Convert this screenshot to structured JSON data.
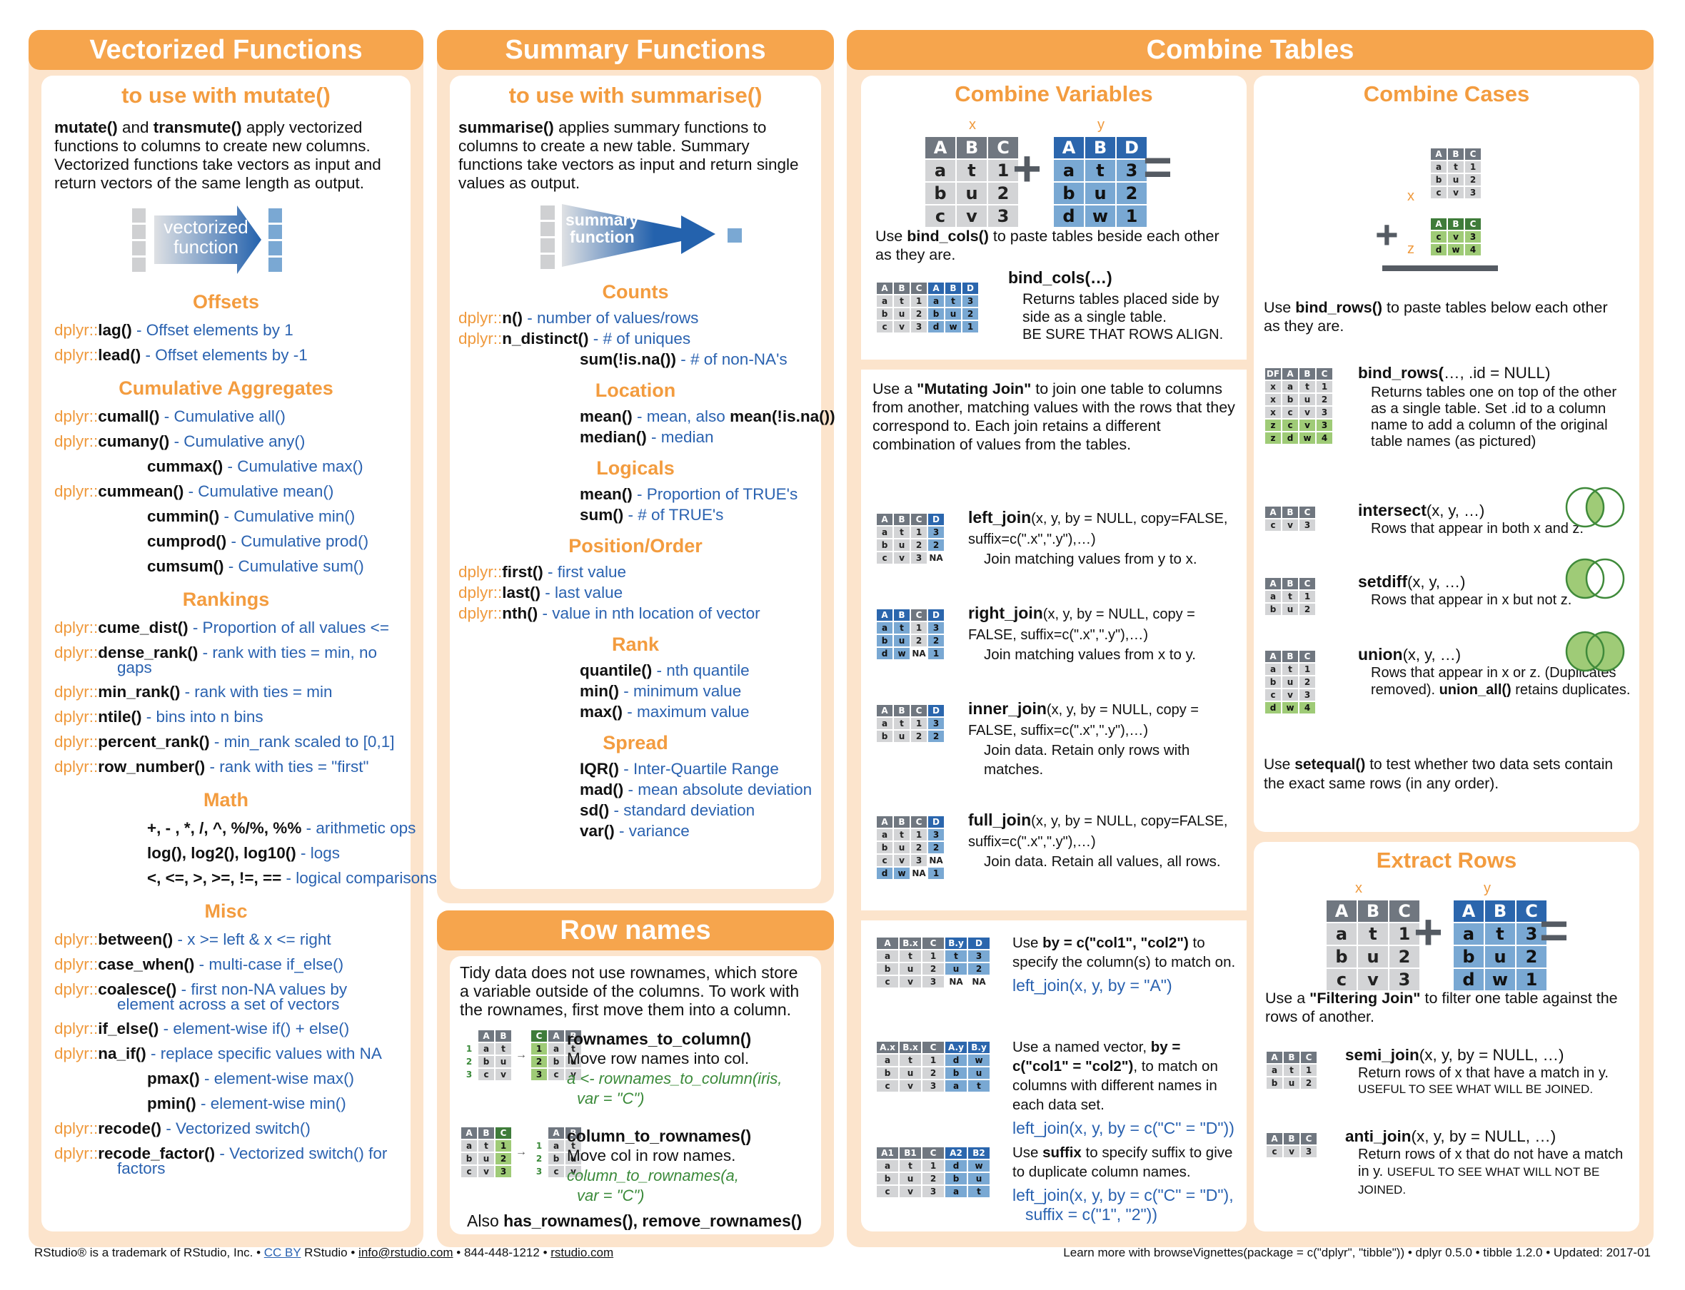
{
  "vectorized": {
    "title": "Vectorized Functions",
    "subtitle": "to use with mutate()",
    "intro_b1": "mutate()",
    "intro_t1": " and ",
    "intro_b2": "transmute()",
    "intro_t2": " apply vectorized functions to columns to create new columns. Vectorized functions take vectors as input and return vectors of the same length as output.",
    "diagram_label1": "vectorized",
    "diagram_label2": "function",
    "sections": [
      {
        "heading": "Offsets",
        "items": [
          {
            "pkg": "dplyr::",
            "name": "lag()",
            "desc": " - Offset elements by 1"
          },
          {
            "pkg": "dplyr::",
            "name": "lead()",
            "desc": " - Offset elements by -1"
          }
        ]
      },
      {
        "heading": "Cumulative Aggregates",
        "items": [
          {
            "pkg": "dplyr::",
            "name": "cumall()",
            "desc": " - Cumulative all()"
          },
          {
            "pkg": "dplyr::",
            "name": "cumany()",
            "desc": " - Cumulative any()"
          },
          {
            "pkg": "",
            "name": "cummax()",
            "desc": " - Cumulative max()"
          },
          {
            "pkg": "dplyr::",
            "name": "cummean()",
            "desc": " - Cumulative mean()"
          },
          {
            "pkg": "",
            "name": "cummin()",
            "desc": " - Cumulative min()"
          },
          {
            "pkg": "",
            "name": "cumprod()",
            "desc": " - Cumulative prod()"
          },
          {
            "pkg": "",
            "name": "cumsum()",
            "desc": " - Cumulative sum()"
          }
        ]
      },
      {
        "heading": "Rankings",
        "items": [
          {
            "pkg": "dplyr::",
            "name": "cume_dist()",
            "desc": " - Proportion of all values <="
          },
          {
            "pkg": "dplyr::",
            "name": "dense_rank()",
            "desc": " - rank with ties = min, no",
            "desc2": "gaps"
          },
          {
            "pkg": "dplyr::",
            "name": "min_rank()",
            "desc": " - rank with ties = min"
          },
          {
            "pkg": "dplyr::",
            "name": "ntile()",
            "desc": " - bins into n bins"
          },
          {
            "pkg": "dplyr::",
            "name": "percent_rank()",
            "desc": " - min_rank scaled to [0,1]"
          },
          {
            "pkg": "dplyr::",
            "name": "row_number()",
            "desc": " - rank with ties = \"first\""
          }
        ]
      },
      {
        "heading": "Math",
        "items": [
          {
            "pkg": "",
            "name": "+, - , *, /, ^, %/%, %%",
            "desc": " - arithmetic ops"
          },
          {
            "pkg": "",
            "name": "log(), log2(), log10()",
            "desc": " - logs"
          },
          {
            "pkg": "",
            "name": "<, <=, >, >=, !=, ==",
            "desc": " - logical comparisons"
          }
        ]
      },
      {
        "heading": "Misc",
        "items": [
          {
            "pkg": "dplyr::",
            "name": "between()",
            "desc": " - x >= left & x <= right"
          },
          {
            "pkg": "dplyr::",
            "name": "case_when()",
            "desc": " - multi-case if_else()"
          },
          {
            "pkg": "dplyr::",
            "name": "coalesce()",
            "desc": " - first non-NA values by",
            "desc2": "element  across a set of vectors"
          },
          {
            "pkg": "dplyr::",
            "name": "if_else()",
            "desc": " - element-wise if() + else()"
          },
          {
            "pkg": "dplyr::",
            "name": "na_if()",
            "desc": " - replace specific values with NA"
          },
          {
            "pkg": "",
            "name": "pmax()",
            "desc": " - element-wise max()"
          },
          {
            "pkg": "",
            "name": "pmin()",
            "desc": " - element-wise min()"
          },
          {
            "pkg": "dplyr::",
            "name": "recode()",
            "desc": " - Vectorized switch()"
          },
          {
            "pkg": "dplyr::",
            "name": "recode_factor()",
            "desc": " - Vectorized switch() for",
            "desc2": "factors"
          }
        ]
      }
    ]
  },
  "summary": {
    "title": "Summary Functions",
    "subtitle": "to use with summarise()",
    "intro_b1": "summarise()",
    "intro_t1": " applies summary functions to columns to create a new table. Summary functions take vectors as input and return single values as output.",
    "diagram_label1": "summary",
    "diagram_label2": "function",
    "sections": [
      {
        "heading": "Counts",
        "items": [
          {
            "pkg": "dplyr::",
            "name": "n()",
            "desc": " - number of values/rows"
          },
          {
            "pkg": "dplyr::",
            "name": "n_distinct()",
            "desc": " - # of uniques"
          },
          {
            "pkg": "",
            "name": "sum(!is.na())",
            "desc": " - # of non-NA's"
          }
        ]
      },
      {
        "heading": "Location",
        "items": [
          {
            "pkg": "",
            "name": "mean()",
            "desc": " - mean, also ",
            "name2": "mean(!is.na())"
          },
          {
            "pkg": "",
            "name": "median()",
            "desc": " - median"
          }
        ]
      },
      {
        "heading": "Logicals",
        "items": [
          {
            "pkg": "",
            "name": "mean()",
            "desc": " - Proportion of TRUE's"
          },
          {
            "pkg": "",
            "name": "sum()",
            "desc": " - # of TRUE's"
          }
        ]
      },
      {
        "heading": "Position/Order",
        "items": [
          {
            "pkg": "dplyr::",
            "name": "first()",
            "desc": " - first value"
          },
          {
            "pkg": "dplyr::",
            "name": "last()",
            "desc": " - last value"
          },
          {
            "pkg": "dplyr::",
            "name": "nth()",
            "desc": " - value in nth location of vector"
          }
        ]
      },
      {
        "heading": "Rank",
        "items": [
          {
            "pkg": "",
            "name": "quantile()",
            "desc": " - nth quantile"
          },
          {
            "pkg": "",
            "name": "min()",
            "desc": " - minimum value"
          },
          {
            "pkg": "",
            "name": "max()",
            "desc": " - maximum value"
          }
        ]
      },
      {
        "heading": "Spread",
        "items": [
          {
            "pkg": "",
            "name": "IQR()",
            "desc": " - Inter-Quartile Range"
          },
          {
            "pkg": "",
            "name": "mad()",
            "desc": " - mean absolute deviation"
          },
          {
            "pkg": "",
            "name": "sd()",
            "desc": " - standard deviation"
          },
          {
            "pkg": "",
            "name": "var()",
            "desc": " - variance"
          }
        ]
      }
    ]
  },
  "rownames": {
    "title": "Row names",
    "intro": "Tidy data does not use rownames, which store a variable outside of the columns. To work with the rownames, first move them into a column.",
    "r2c_name": "rownames_to_column()",
    "r2c_desc": "Move row names into col.",
    "r2c_code1": "a <- rownames_to_column(iris,",
    "r2c_code2": "var = \"C\")",
    "c2r_name": "column_to_rownames()",
    "c2r_desc": "Move col in row names.",
    "c2r_code1": "column_to_rownames(a,",
    "c2r_code2": "var = \"C\")",
    "also_t": "Also ",
    "also_b": "has_rownames(), remove_rownames()"
  },
  "combine": {
    "title": "Combine Tables",
    "vars": {
      "title": "Combine Variables",
      "label_x": "x",
      "label_y": "y",
      "bind_cols_intro_t1": "Use ",
      "bind_cols_intro_b": "bind_cols()",
      "bind_cols_intro_t2": " to paste tables beside each other as they are.",
      "bind_cols_sig": "bind_cols(…)",
      "bind_cols_desc": "Returns tables placed side by side as a single table.",
      "bind_cols_warn": "BE SURE THAT ROWS ALIGN.",
      "mutating_t1": "Use a ",
      "mutating_b": "\"Mutating Join\"",
      "mutating_t2": " to join one table to columns from another, matching values with the rows that they correspond to.  Each join retains a different combination of values from the tables.",
      "joins": [
        {
          "name": "left_join",
          "args": "(x, y, by = NULL, copy=FALSE,  suffix=c(\".x\",\".y\"),…)",
          "desc": "Join matching values from y to x."
        },
        {
          "name": "right_join",
          "args": "(x, y, by = NULL, copy = FALSE,  suffix=c(\".x\",\".y\"),…)",
          "desc": "Join matching values from x to y."
        },
        {
          "name": "inner_join",
          "args": "(x, y, by = NULL, copy = FALSE,  suffix=c(\".x\",\".y\"),…)",
          "desc": "Join data. Retain only rows with matches."
        },
        {
          "name": "full_join",
          "args": "(x, y, by = NULL, copy=FALSE,  suffix=c(\".x\",\".y\"),…)",
          "desc": "Join data. Retain all values, all rows."
        }
      ],
      "by1_t1": "Use ",
      "by1_b": "by = c(\"col1\", \"col2\")",
      "by1_t2": "  to specify the column(s) to match on.",
      "by1_code": "left_join(x, y, by = \"A\")",
      "by2_t1": "Use a named vector, ",
      "by2_b": "by = c(\"col1\" = \"col2\")",
      "by2_t2": ", to match on columns with different names in each data set.",
      "by2_code": "left_join(x, y, by = c(\"C\" = \"D\"))",
      "by3_t1": "Use ",
      "by3_b": "suffix",
      "by3_t2": " to specify suffix to give to duplicate column names.",
      "by3_code1": "left_join(x, y, by = c(\"C\" = \"D\"),",
      "by3_code2": "suffix = c(\"1\", \"2\"))"
    },
    "cases": {
      "title": "Combine Cases",
      "label_x": "x",
      "label_z": "z",
      "intro_t1": "Use ",
      "intro_b": "bind_rows()",
      "intro_t2": " to paste tables below each other as they are.",
      "bind_rows_sig_b": "bind_rows(",
      "bind_rows_sig_t": "…, .id = NULL)",
      "bind_rows_desc": "Returns tables one on top of the other as a single table. Set .id to a column name to add a column of the original table names (as pictured)",
      "sets": [
        {
          "name": "intersect",
          "args": "(x, y, …)",
          "desc": "Rows that appear in both x and z."
        },
        {
          "name": "setdiff",
          "args": "(x, y, …)",
          "desc": "Rows that appear in x but not z."
        },
        {
          "name": "union",
          "args": "(x, y, …)",
          "desc": "Rows that appear in x or z. (Duplicates removed). ",
          "desc_b": "union_all()",
          "desc2": " retains duplicates."
        }
      ],
      "setequal_t1": "Use ",
      "setequal_b": "setequal()",
      "setequal_t2": " to test whether two data sets contain the exact same rows (in any order)."
    },
    "extract": {
      "title": "Extract Rows",
      "label_x": "x",
      "label_y": "y",
      "intro_t1": "Use a ",
      "intro_b": "\"Filtering Join\"",
      "intro_t2": " to filter one table against the rows of another.",
      "semi_name": "semi_join",
      "semi_args": "(x, y, by = NULL, …)",
      "semi_desc": "Return rows of x that have a match in y.",
      "semi_note": "USEFUL TO SEE WHAT WILL BE JOINED.",
      "anti_name": "anti_join",
      "anti_args": "(x, y, by = NULL, …)",
      "anti_desc": "Return rows of x that do not have a match in y. ",
      "anti_note": "USEFUL TO SEE WHAT WILL NOT BE JOINED."
    }
  },
  "tables": {
    "x": {
      "head": [
        "A",
        "B",
        "C"
      ],
      "rows": [
        [
          "a",
          "t",
          "1"
        ],
        [
          "b",
          "u",
          "2"
        ],
        [
          "c",
          "v",
          "3"
        ]
      ]
    },
    "y": {
      "head": [
        "A",
        "B",
        "D"
      ],
      "rows": [
        [
          "a",
          "t",
          "3"
        ],
        [
          "b",
          "u",
          "2"
        ],
        [
          "d",
          "w",
          "1"
        ]
      ]
    },
    "z": {
      "head": [
        "A",
        "B",
        "C"
      ],
      "rows": [
        [
          "c",
          "v",
          "3"
        ],
        [
          "d",
          "w",
          "4"
        ]
      ]
    },
    "y2": {
      "head": [
        "A",
        "B",
        "C"
      ],
      "rows": [
        [
          "a",
          "t",
          "3"
        ],
        [
          "b",
          "u",
          "2"
        ],
        [
          "d",
          "w",
          "1"
        ]
      ]
    }
  },
  "footer": {
    "left_1": "RStudio® is a trademark of RStudio, Inc.  •  ",
    "left_cc": "CC BY",
    "left_2": " RStudio •  ",
    "left_email": "info@rstudio.com",
    "left_3": "  •  844-448-1212 • ",
    "left_site": "rstudio.com",
    "right": "Learn more with browseVignettes(package = c(\"dplyr\", \"tibble\"))  •  dplyr 0.5.0 •  tibble 1.2.0  •  Updated: 2017-01"
  }
}
